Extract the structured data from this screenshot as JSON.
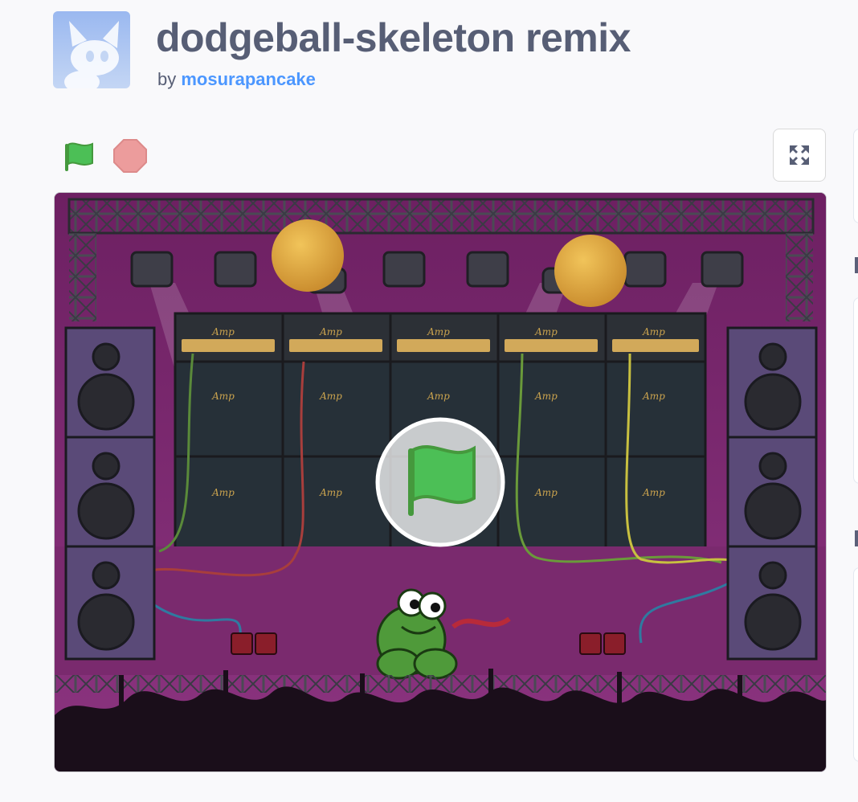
{
  "project": {
    "title": "dodgeball-skeleton remix",
    "by_prefix": "by",
    "author": "mosurapancake"
  },
  "controls": {
    "green_flag_icon": "green-flag-icon",
    "stop_icon": "stop-sign-icon",
    "fullscreen_icon": "fullscreen-icon"
  },
  "stage": {
    "amp_label": "Amp",
    "overlay_icon": "green-flag-icon"
  },
  "colors": {
    "title": "#575e75",
    "author_link": "#4c97ff",
    "flag_green": "#4cbf56",
    "stop_red": "#ec9c9c",
    "stage_purple": "#7a2a6e"
  }
}
